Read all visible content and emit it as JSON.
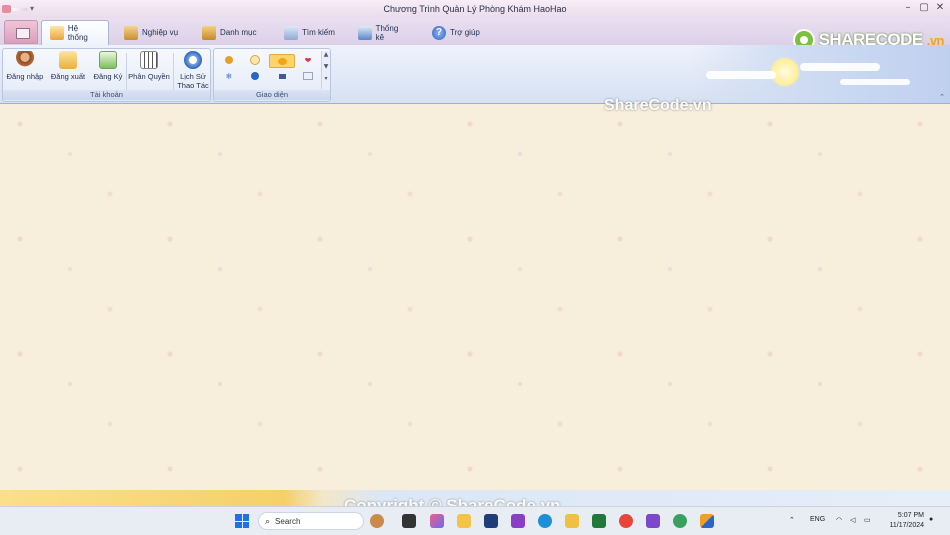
{
  "window": {
    "title": "Chương Trình Quản Lý Phòng Khám HaoHao",
    "controls": [
      "–",
      "▢",
      "✕"
    ]
  },
  "tabs": [
    {
      "label": "Hệ thống",
      "icon": "home-icon",
      "active": true
    },
    {
      "label": "Nghiệp vụ",
      "icon": "clipboard-icon",
      "active": false
    },
    {
      "label": "Danh mục",
      "icon": "catalog-icon",
      "active": false
    },
    {
      "label": "Tìm kiếm",
      "icon": "search-document-icon",
      "active": false
    },
    {
      "label": "Thống kê",
      "icon": "chart-icon",
      "active": false
    },
    {
      "label": "Trợ giúp",
      "icon": "help-icon",
      "active": false
    }
  ],
  "logo": {
    "brand": "SHARECODE",
    "suffix": ".vn"
  },
  "ribbon": {
    "groups": [
      {
        "label": "Tài khoản",
        "buttons": [
          {
            "label": "Đăng nhập",
            "icon": "user-login-icon"
          },
          {
            "label": "Đăng xuất",
            "icon": "folder-logout-icon"
          },
          {
            "label": "Đăng Ký",
            "icon": "register-icon"
          },
          {
            "label": "Phân Quyền",
            "icon": "permission-icon"
          },
          {
            "label_line1": "Lịch Sử",
            "label_line2": "Thao Tác",
            "icon": "history-icon"
          }
        ]
      },
      {
        "label": "Giao diện",
        "gallery": [
          "skin-1",
          "skin-2",
          "skin-3-selected",
          "skin-4",
          "skin-5",
          "skin-6",
          "skin-7",
          "skin-8"
        ]
      }
    ]
  },
  "watermarks": {
    "top": "ShareCode.vn",
    "bottom": "Copyright © ShareCode.vn"
  },
  "taskbar": {
    "search_placeholder": "Search",
    "language": "ENG",
    "time": "5:07 PM",
    "date": "11/17/2024"
  },
  "colors": {
    "accent": "#3a6fd8",
    "workspace_bg": "#f7eedb",
    "logo_green": "#7cc042",
    "logo_orange": "#f7a21b"
  }
}
